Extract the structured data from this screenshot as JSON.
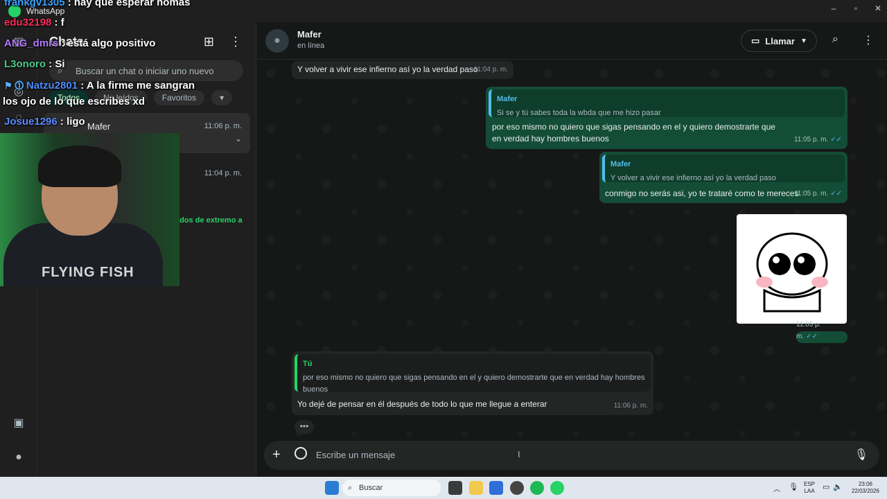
{
  "window": {
    "title": "WhatsApp"
  },
  "chatlist": {
    "title": "Chats",
    "search_placeholder": "Buscar un chat o iniciar uno nuevo",
    "filters": [
      "Todos",
      "No leídos",
      "Favoritos"
    ],
    "chats": [
      {
        "name": "Mafer",
        "time": "11:06 p. m.",
        "preview": ""
      },
      {
        "name": "",
        "time": "11:04 p. m.",
        "preview": "ados de extremo a"
      }
    ]
  },
  "conversation": {
    "contact_name": "Mafer",
    "contact_status": "en línea",
    "call_label": "Llamar",
    "messages": [
      {
        "dir": "in",
        "text": "Y volver a vivir ese infierno así yo la verdad paso",
        "time": "11:04 p. m."
      },
      {
        "dir": "out",
        "quote_name": "Mafer",
        "quote_text": "Si se y tú sabes toda la wbda que me hizo pasar",
        "text": "por eso mismo no quiero que sigas pensando en el y quiero demostrarte que en verdad hay hombres buenos",
        "time": "11:05 p. m."
      },
      {
        "dir": "out",
        "quote_name": "Mafer",
        "quote_text": "Y volver a vivir ese infierno así yo la verdad paso",
        "text": "conmigo no serás asi, yo te trataré como te mereces",
        "time": "11:05 p. m."
      },
      {
        "dir": "out",
        "sticker": true,
        "time": "11:05 p. m."
      },
      {
        "dir": "in",
        "quote_name": "Tú",
        "quote_text": "por eso mismo no quiero que sigas pensando en el y quiero demostrarte que en verdad hay hombres buenos",
        "text": "Yo dejé de pensar en él después de todo lo que me llegue a enterar",
        "time": "11:06 p. m."
      }
    ],
    "composer_placeholder": "Escribe un mensaje"
  },
  "stream_chat": [
    {
      "user": "frankgv1305",
      "color": "#3aa0ff",
      "text": " : hay que esperar nomas"
    },
    {
      "user": "edu32198",
      "color": "#ff2a5a",
      "text": " : f"
    },
    {
      "user": "ANG_dmrs",
      "color": "#b57bff",
      "text": " : está algo positivo"
    },
    {
      "user": "L3onoro",
      "color": "#4ecb8a",
      "text": " : Si"
    },
    {
      "user": "Natzu2801",
      "color": "#4d8cff",
      "text": " : A la firme me sangran"
    },
    {
      "user": "",
      "color": "#ffffff",
      "text": "los ojo de lo que escribes xd"
    },
    {
      "user": "Josue1296",
      "color": "#5b8cff",
      "text": " : ligo"
    }
  ],
  "webcam": {
    "shirt_text": "FLYING FISH"
  },
  "taskbar": {
    "search_label": "Buscar",
    "lang": "ESP",
    "lang2": "LAA",
    "time": "23:06",
    "date": "22/03/2026"
  }
}
